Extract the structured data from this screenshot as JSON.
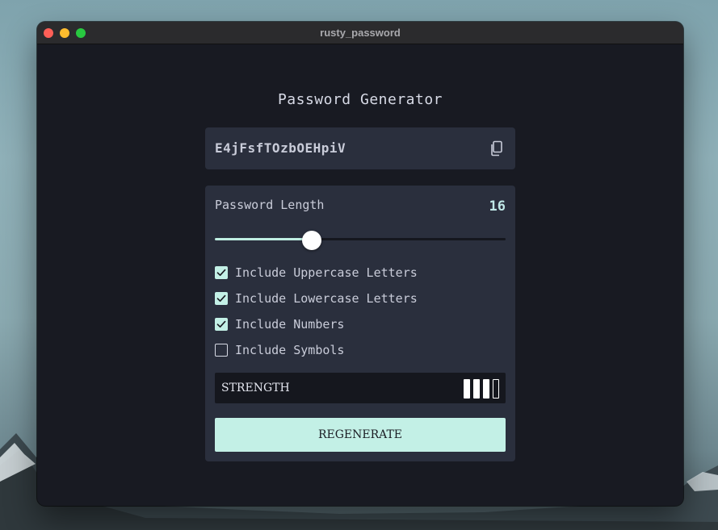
{
  "window": {
    "title": "rusty_password"
  },
  "app": {
    "heading": "Password Generator",
    "password": "E4jFsfTOzbOEHpiV",
    "copy_icon": "copy-icon",
    "length": {
      "label": "Password Length",
      "value": "16",
      "slider_fraction": 0.333
    },
    "options": [
      {
        "label": "Include Uppercase Letters",
        "checked": true
      },
      {
        "label": "Include Lowercase Letters",
        "checked": true
      },
      {
        "label": "Include Numbers",
        "checked": true
      },
      {
        "label": "Include Symbols",
        "checked": false
      }
    ],
    "strength": {
      "label": "STRENGTH",
      "level": 3,
      "max_level": 4
    },
    "regenerate_label": "REGENERATE"
  },
  "colors": {
    "accent": "#c3f0e6",
    "panel": "#2a2f3d",
    "window_bg": "#181a22"
  }
}
